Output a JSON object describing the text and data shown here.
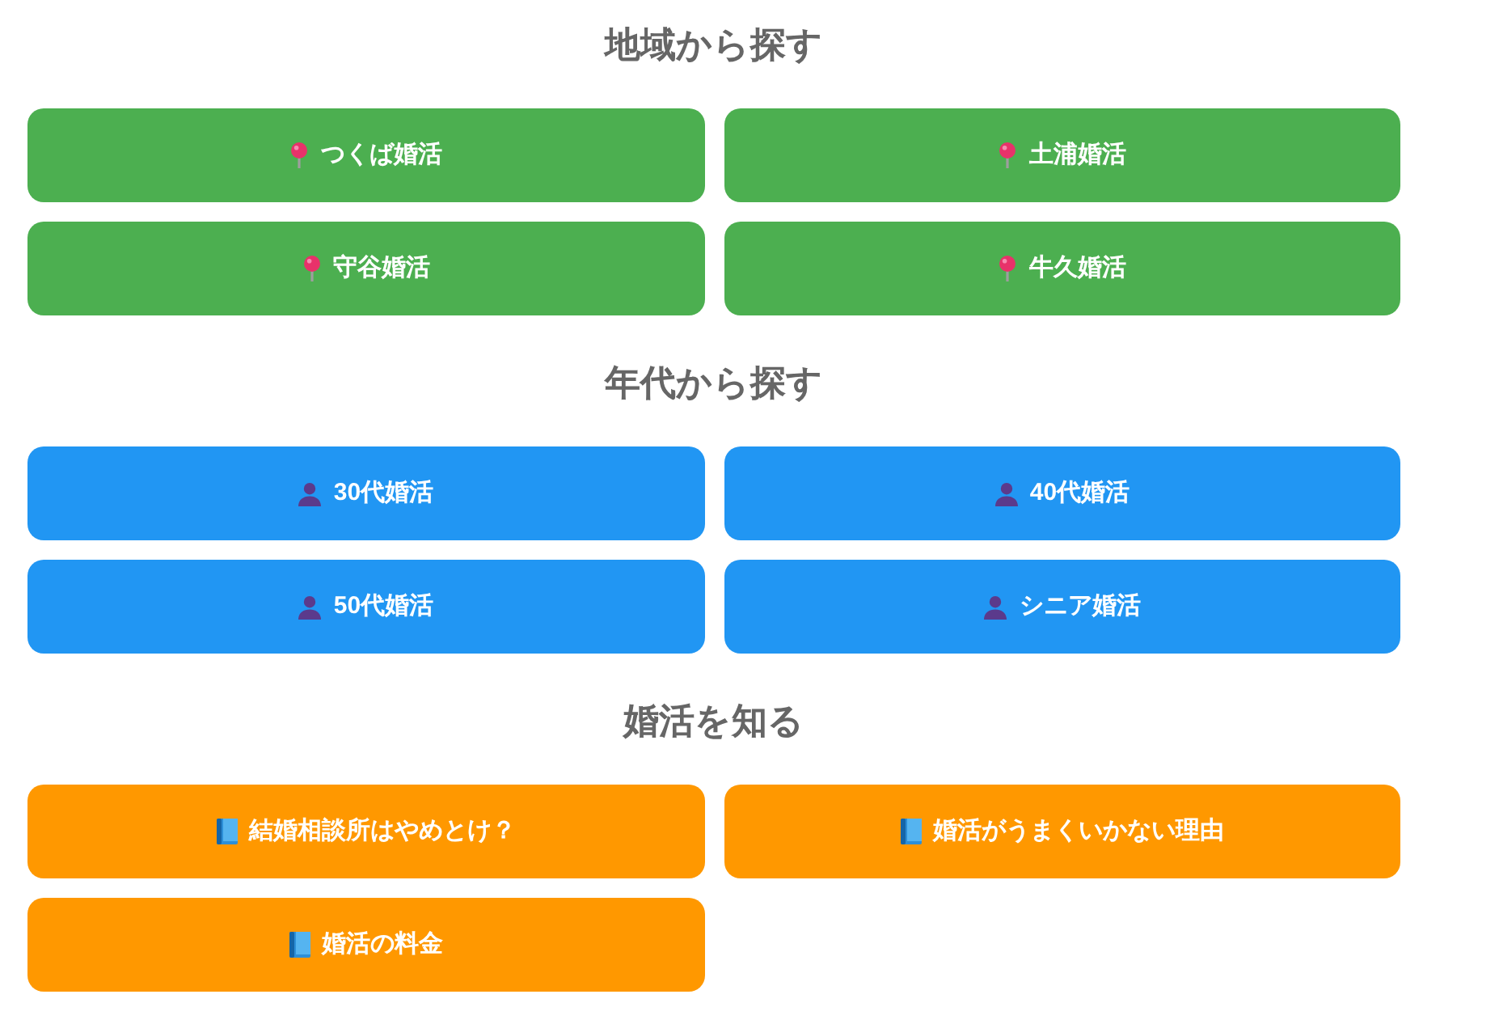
{
  "sections": [
    {
      "title": "地域から探す",
      "color": "#4caf50",
      "kind": "pin",
      "links": [
        "つくば婚活",
        "土浦婚活",
        "守谷婚活",
        "牛久婚活"
      ]
    },
    {
      "title": "年代から探す",
      "color": "#2196f3",
      "kind": "person",
      "links": [
        "30代婚活",
        "40代婚活",
        "50代婚活",
        "シニア婚活"
      ]
    },
    {
      "title": "婚活を知る",
      "color": "#ff9800",
      "kind": "book",
      "links": [
        "結婚相談所はやめとけ？",
        "婚活がうまくいかない理由",
        "婚活の料金"
      ]
    }
  ]
}
